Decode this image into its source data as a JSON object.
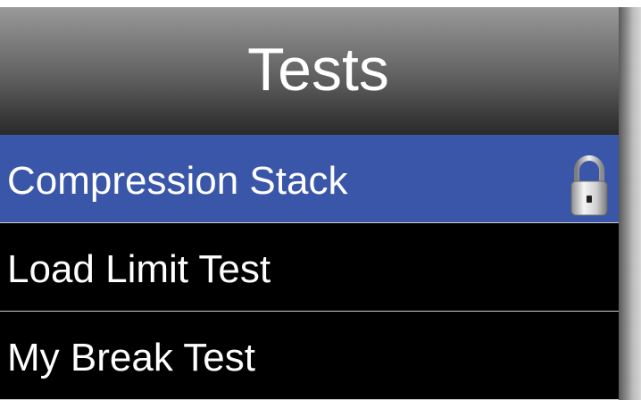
{
  "header": {
    "title": "Tests"
  },
  "list": {
    "items": [
      {
        "label": "Compression Stack",
        "selected": true,
        "locked": true
      },
      {
        "label": "Load Limit Test",
        "selected": false,
        "locked": false
      },
      {
        "label": "My Break Test",
        "selected": false,
        "locked": false
      }
    ]
  },
  "icons": {
    "lock": "lock-icon"
  },
  "colors": {
    "selected_row": "#3a56a8",
    "background": "#000000",
    "text": "#ffffff",
    "divider": "#cfcfcf"
  }
}
